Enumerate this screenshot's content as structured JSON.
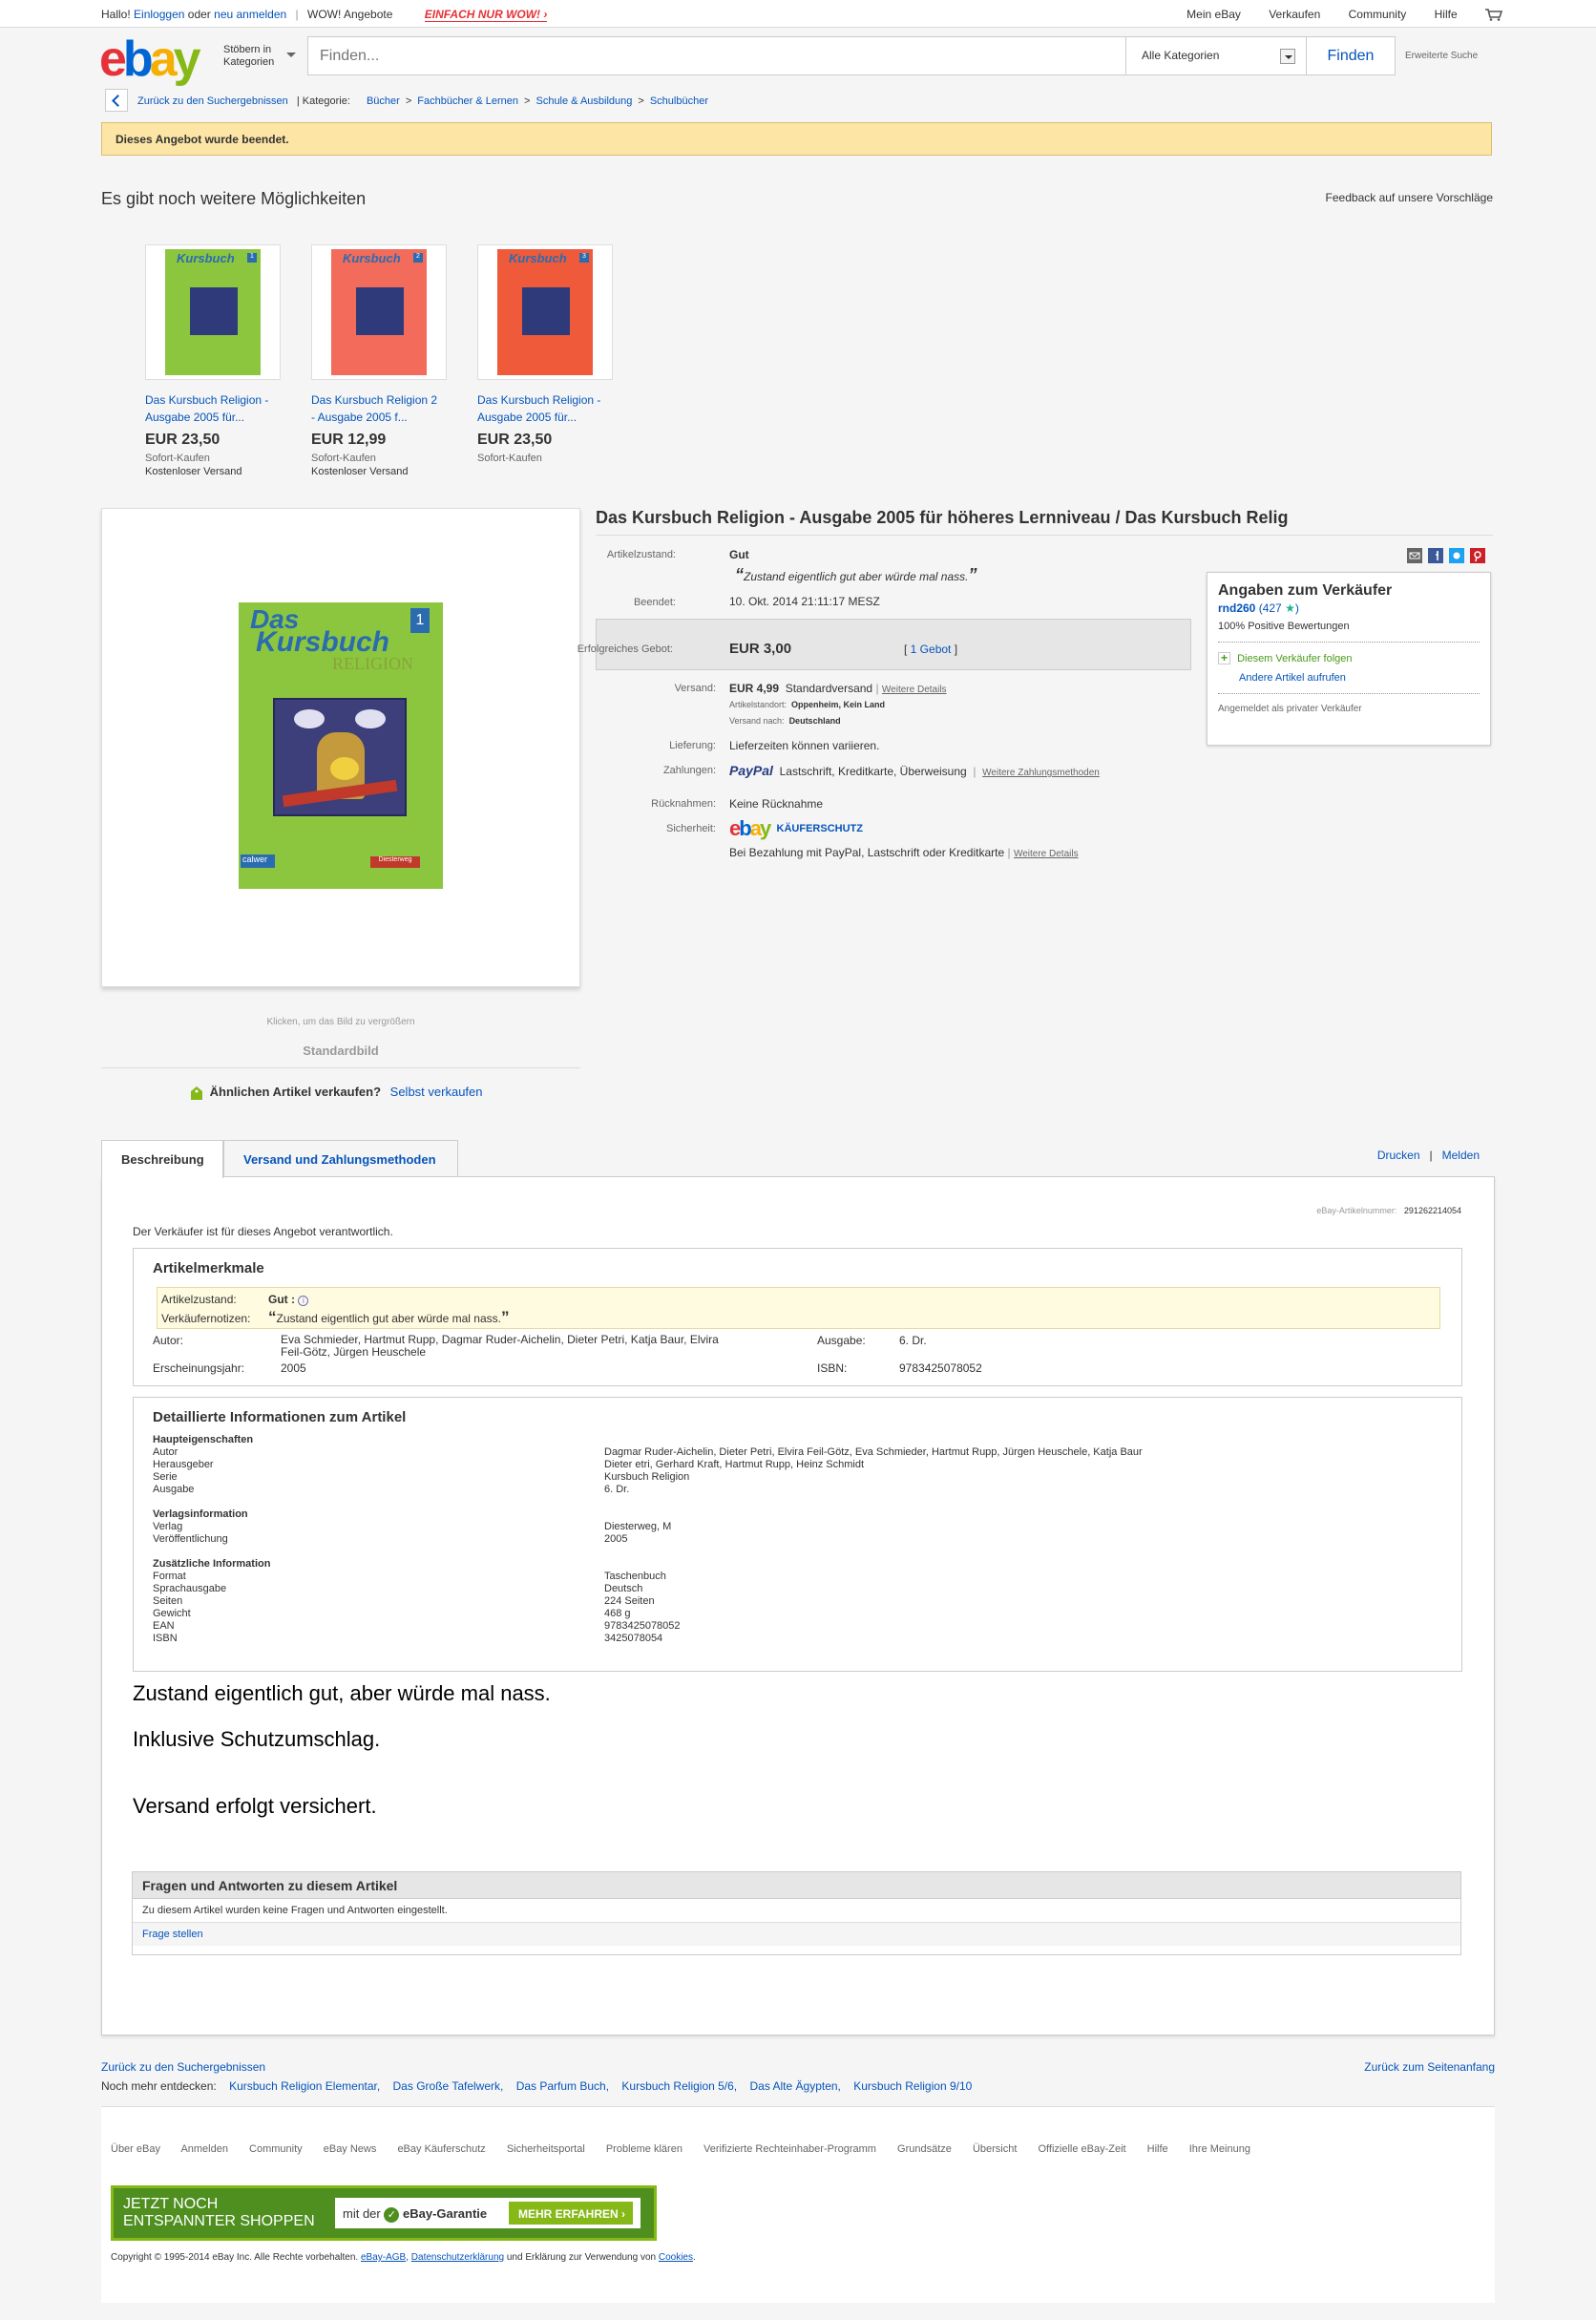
{
  "topbar": {
    "hello": "Hallo!",
    "login": "Einloggen",
    "or": "oder",
    "register": "neu anmelden",
    "wow_offers": "WOW! Angebote",
    "wow_banner": "EINFACH NUR WOW!",
    "my_ebay": "Mein eBay",
    "sell": "Verkaufen",
    "community": "Community",
    "help": "Hilfe",
    "cart_icon": "cart-icon"
  },
  "header": {
    "logo": [
      "e",
      "b",
      "a",
      "y"
    ],
    "browse_line1": "Stöbern in",
    "browse_line2": "Kategorien",
    "search_placeholder": "Finden...",
    "category": "Alle Kategorien",
    "find": "Finden",
    "advanced": "Erweiterte Suche"
  },
  "breadcrumb": {
    "back": "Zurück zu den Suchergebnissen",
    "category_label": "| Kategorie:",
    "items": [
      "Bücher",
      "Fachbücher & Lernen",
      "Schule & Ausbildung",
      "Schulbücher"
    ]
  },
  "banner": {
    "ended": "Dieses Angebot wurde beendet."
  },
  "recommendations": {
    "title": "Es gibt noch weitere Möglichkeiten",
    "feedback": "Feedback auf unsere Vorschläge",
    "items": [
      {
        "title_l1": "Das Kursbuch Religion -",
        "title_l2": "Ausgabe 2005 für...",
        "price": "EUR 23,50",
        "type": "Sofort-Kaufen",
        "shipping": "Kostenloser Versand",
        "color": "#8cc63f",
        "num": "1"
      },
      {
        "title_l1": "Das Kursbuch Religion 2",
        "title_l2": "- Ausgabe 2005 f...",
        "price": "EUR 12,99",
        "type": "Sofort-Kaufen",
        "shipping": "Kostenloser Versand",
        "color": "#f26b5b",
        "num": "2"
      },
      {
        "title_l1": "Das Kursbuch Religion -",
        "title_l2": "Ausgabe 2005 für...",
        "price": "EUR 23,50",
        "type": "Sofort-Kaufen",
        "shipping": "",
        "color": "#ee5a3a",
        "num": "3"
      }
    ]
  },
  "image": {
    "book_title_1": "Das",
    "book_title_2": "Kursbuch",
    "book_title_3": "RELIGION",
    "book_num": "1",
    "publisher_1": "calwer",
    "publisher_2": "Diesterweg",
    "caption": "Klicken, um das Bild zu vergrößern",
    "standard": "Standardbild",
    "sell_similar": "Ähnlichen Artikel verkaufen?",
    "sell_link": "Selbst verkaufen"
  },
  "item": {
    "title": "Das Kursbuch Religion - Ausgabe 2005 für höheres Lernniveau / Das Kursbuch Relig",
    "condition_label": "Artikelzustand:",
    "condition": "Gut",
    "condition_note": "Zustand eigentlich gut aber würde mal nass.",
    "ended_label": "Beendet:",
    "ended": "10. Okt. 2014  21:11:17 MESZ",
    "bid_label": "Erfolgreiches Gebot:",
    "bid": "EUR 3,00",
    "bid_count": "1 Gebot",
    "shipping_label": "Versand:",
    "shipping_price": "EUR 4,99",
    "shipping_type": "Standardversand",
    "details": "Weitere Details",
    "location_label": "Artikelstandort:",
    "location": "Oppenheim, Kein Land",
    "ship_to_label": "Versand nach:",
    "ship_to": "Deutschland",
    "delivery_label": "Lieferung:",
    "delivery": "Lieferzeiten können variieren.",
    "payment_label": "Zahlungen:",
    "paypal": "PayPal",
    "payment_methods": "Lastschrift,   Kreditkarte,   Überweisung",
    "payment_more": "Weitere Zahlungsmethoden",
    "returns_label": "Rücknahmen:",
    "returns": "Keine Rücknahme",
    "security_label": "Sicherheit:",
    "buyer_protection": "KÄUFERSCHUTZ",
    "security_text": "Bei Bezahlung mit PayPal, Lastschrift oder Kreditkarte",
    "security_details": "Weitere Details"
  },
  "seller": {
    "heading": "Angaben zum Verkäufer",
    "name": "rnd260",
    "score": "427",
    "positive": "100% Positive Bewertungen",
    "follow": "Diesem Verkäufer folgen",
    "other_items": "Andere Artikel aufrufen",
    "registered": "Angemeldet als privater Verkäufer"
  },
  "tabs": {
    "description": "Beschreibung",
    "shipping": "Versand und Zahlungsmethoden",
    "print": "Drucken",
    "report": "Melden"
  },
  "description": {
    "item_number_label": "eBay-Artikelnummer:",
    "item_number": "291262214054",
    "responsible": "Der Verkäufer ist für dieses Angebot verantwortlich.",
    "specifics_title": "Artikelmerkmale",
    "condition_label": "Artikelzustand:",
    "condition": "Gut :",
    "seller_notes_label": "Verkäufernotizen:",
    "seller_notes": "Zustand eigentlich gut aber würde mal nass.",
    "author_label": "Autor:",
    "author_l1": "Eva Schmieder, Hartmut Rupp, Dagmar Ruder-Aichelin, Dieter Petri, Katja Baur, Elvira",
    "author_l2": "Feil-Götz, Jürgen Heuschele",
    "edition_label": "Ausgabe:",
    "edition": "6. Dr.",
    "year_label": "Erscheinungsjahr:",
    "year": "2005",
    "isbn_label": "ISBN:",
    "isbn": "9783425078052",
    "details_title": "Detaillierte Informationen zum Artikel",
    "groups": [
      {
        "title": "Haupteigenschaften",
        "rows": [
          [
            "Autor",
            "Dagmar Ruder-Aichelin, Dieter Petri, Elvira Feil-Götz, Eva Schmieder, Hartmut Rupp, Jürgen Heuschele, Katja Baur"
          ],
          [
            "Herausgeber",
            "Dieter etri, Gerhard Kraft, Hartmut Rupp, Heinz Schmidt"
          ],
          [
            "Serie",
            "Kursbuch Religion"
          ],
          [
            "Ausgabe",
            "6. Dr."
          ]
        ]
      },
      {
        "title": "Verlagsinformation",
        "rows": [
          [
            "Verlag",
            "Diesterweg, M"
          ],
          [
            "Veröffentlichung",
            "2005"
          ]
        ]
      },
      {
        "title": "Zusätzliche Information",
        "rows": [
          [
            "Format",
            "Taschenbuch"
          ],
          [
            "Sprachausgabe",
            "Deutsch"
          ],
          [
            "Seiten",
            "224 Seiten"
          ],
          [
            "Gewicht",
            "468 g"
          ],
          [
            "EAN",
            "9783425078052"
          ],
          [
            "ISBN",
            "3425078054"
          ]
        ]
      }
    ],
    "text1": "Zustand eigentlich gut, aber würde mal nass.",
    "text2": "Inklusive Schutzumschlag.",
    "text3": "Versand erfolgt versichert."
  },
  "qa": {
    "title": "Fragen und Antworten zu diesem Artikel",
    "none": "Zu diesem Artikel wurden keine Fragen und Antworten eingestellt.",
    "ask": "Frage stellen"
  },
  "footer": {
    "back": "Zurück zu den Suchergebnissen",
    "top": "Zurück zum Seitenanfang",
    "more_label": "Noch mehr entdecken:",
    "more": [
      "Kursbuch Religion Elementar,",
      "Das Große Tafelwerk,",
      "Das Parfum Buch,",
      "Kursbuch Religion 5/6,",
      "Das Alte Ägypten,",
      "Kursbuch Religion 9/10"
    ],
    "links": [
      "Über eBay",
      "Anmelden",
      "Community",
      "eBay News",
      "eBay Käuferschutz",
      "Sicherheitsportal",
      "Probleme klären",
      "Verifizierte Rechteinhaber-Programm",
      "Grundsätze",
      "Übersicht",
      "Offizielle eBay-Zeit",
      "Hilfe",
      "Ihre Meinung"
    ],
    "promo_l1": "JETZT NOCH",
    "promo_l2": "ENTSPANNTER SHOPPEN",
    "promo_with": "mit der",
    "promo_guarantee": "eBay-Garantie",
    "promo_btn": "MEHR ERFAHREN",
    "copyright": "Copyright © 1995-2014 eBay Inc. Alle Rechte vorbehalten.",
    "agb": "eBay-AGB",
    "privacy": "Datenschutzerklärung",
    "and": "und Erklärung zur Verwendung von",
    "cookies": "Cookies"
  }
}
